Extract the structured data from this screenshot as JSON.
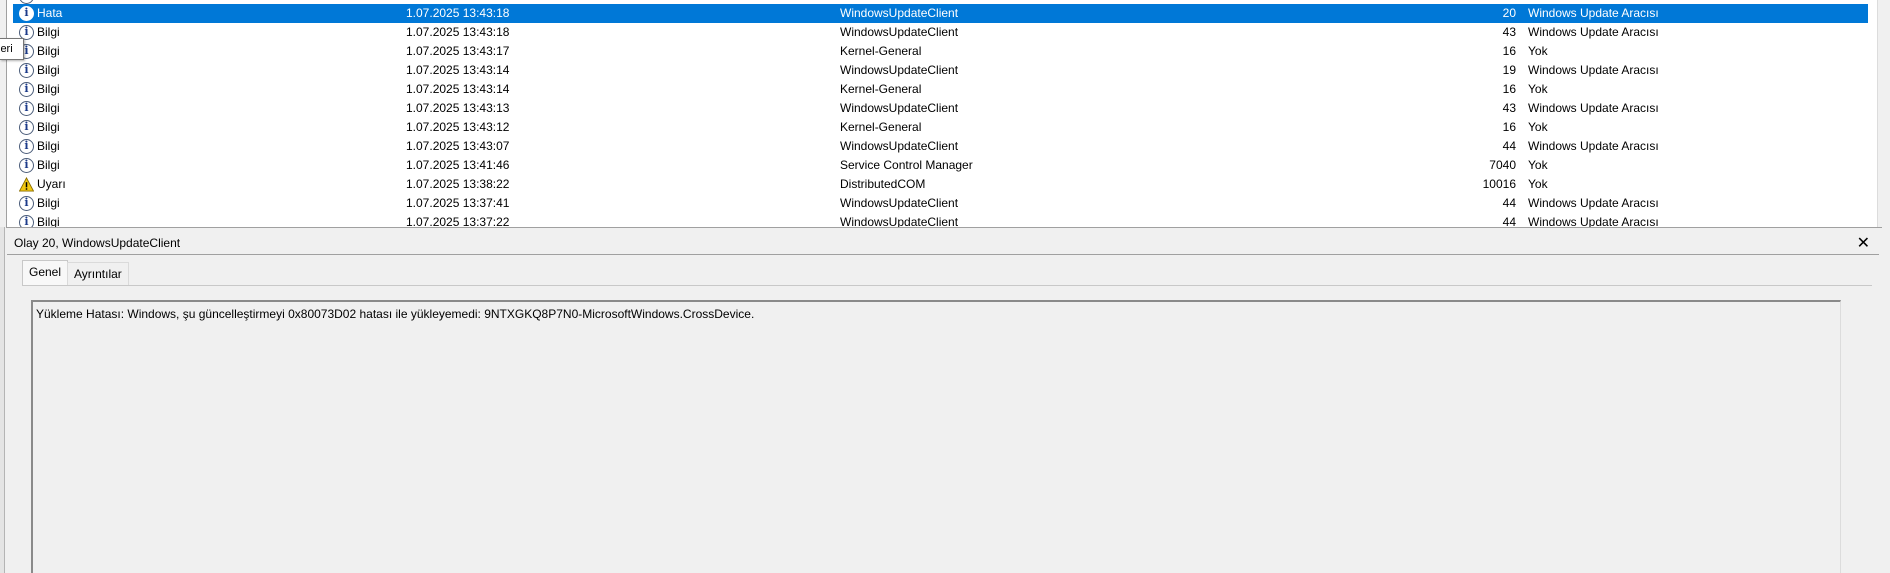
{
  "event_list": {
    "rows": [
      {
        "level": "Hata",
        "icon": "info-icon",
        "date": "1.07.2025 13:43:18",
        "source": "WindowsUpdateClient",
        "event_id": "20",
        "task": "Windows Update Aracısı",
        "selected": true
      },
      {
        "level": "Bilgi",
        "icon": "info-icon",
        "date": "1.07.2025 13:43:18",
        "source": "WindowsUpdateClient",
        "event_id": "43",
        "task": "Windows Update Aracısı"
      },
      {
        "level": "Bilgi",
        "icon": "info-icon",
        "date": "1.07.2025 13:43:17",
        "source": "Kernel-General",
        "event_id": "16",
        "task": "Yok"
      },
      {
        "level": "Bilgi",
        "icon": "info-icon",
        "date": "1.07.2025 13:43:14",
        "source": "WindowsUpdateClient",
        "event_id": "19",
        "task": "Windows Update Aracısı"
      },
      {
        "level": "Bilgi",
        "icon": "info-icon",
        "date": "1.07.2025 13:43:14",
        "source": "Kernel-General",
        "event_id": "16",
        "task": "Yok"
      },
      {
        "level": "Bilgi",
        "icon": "info-icon",
        "date": "1.07.2025 13:43:13",
        "source": "WindowsUpdateClient",
        "event_id": "43",
        "task": "Windows Update Aracısı"
      },
      {
        "level": "Bilgi",
        "icon": "info-icon",
        "date": "1.07.2025 13:43:12",
        "source": "Kernel-General",
        "event_id": "16",
        "task": "Yok"
      },
      {
        "level": "Bilgi",
        "icon": "info-icon",
        "date": "1.07.2025 13:43:07",
        "source": "WindowsUpdateClient",
        "event_id": "44",
        "task": "Windows Update Aracısı"
      },
      {
        "level": "Bilgi",
        "icon": "info-icon",
        "date": "1.07.2025 13:41:46",
        "source": "Service Control Manager",
        "event_id": "7040",
        "task": "Yok"
      },
      {
        "level": "Uyarı",
        "icon": "warning-icon",
        "date": "1.07.2025 13:38:22",
        "source": "DistributedCOM",
        "event_id": "10016",
        "task": "Yok"
      },
      {
        "level": "Bilgi",
        "icon": "info-icon",
        "date": "1.07.2025 13:37:41",
        "source": "WindowsUpdateClient",
        "event_id": "44",
        "task": "Windows Update Aracısı"
      },
      {
        "level": "Bilgi",
        "icon": "info-icon",
        "date": "1.07.2025 13:37:22",
        "source": "WindowsUpdateClient",
        "event_id": "44",
        "task": "Windows Update Aracısı"
      }
    ]
  },
  "tooltip": {
    "text": "leri"
  },
  "detail": {
    "title": "Olay 20, WindowsUpdateClient",
    "close_glyph": "✕",
    "tabs": [
      {
        "label": "Genel",
        "active": true
      },
      {
        "label": "Ayrıntılar",
        "active": false
      }
    ],
    "message": "Yükleme Hatası: Windows, şu güncelleştirmeyi 0x80073D02 hatası ile yükleyemedi: 9NTXGKQ8P7N0-MicrosoftWindows.CrossDevice."
  },
  "colors": {
    "selection": "#0078d7",
    "selection_text": "#ffffff",
    "warning": "#f2c811"
  }
}
